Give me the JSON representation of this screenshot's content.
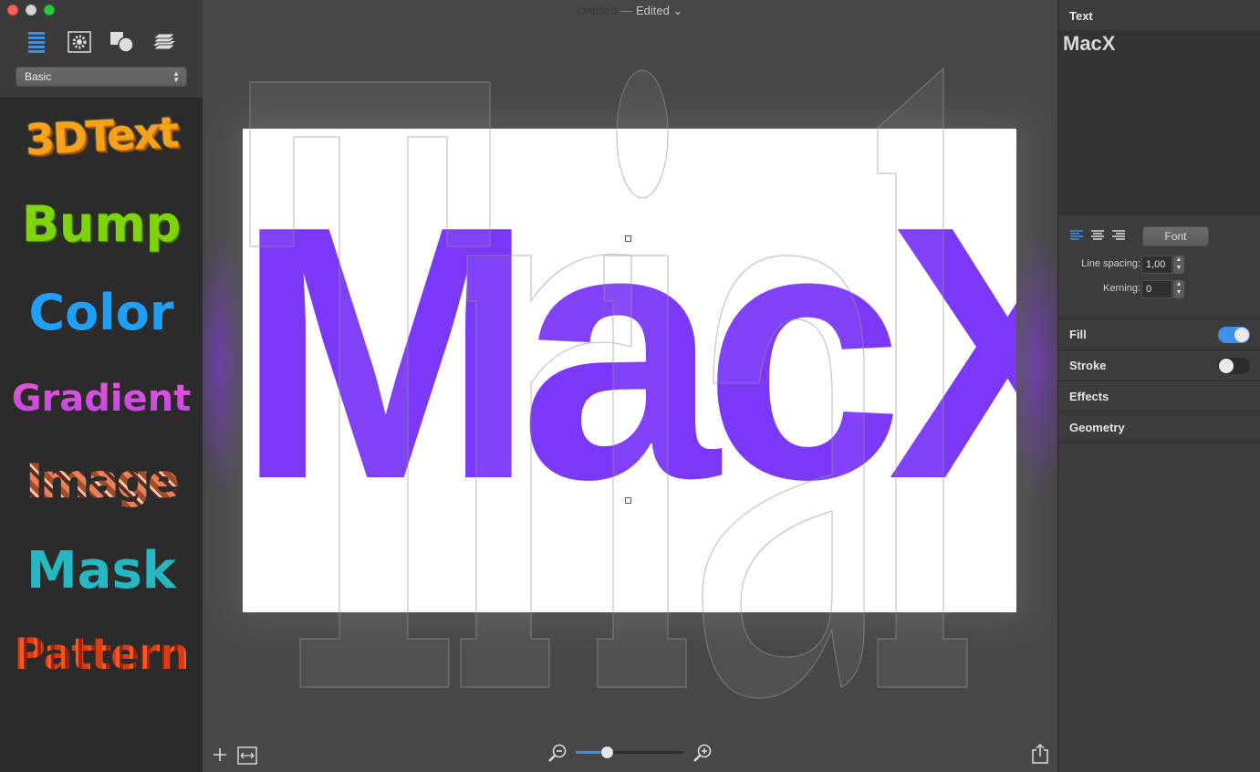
{
  "window": {
    "doc_name": "Untitled",
    "separator": "—",
    "status": "Edited",
    "status_chevron": "⌄"
  },
  "sidebar": {
    "toolbar_icons": [
      "list-icon",
      "gear-icon",
      "shapes-icon",
      "layers-icon"
    ],
    "preset_select": {
      "value": "Basic",
      "arrows": "▲\n▼"
    },
    "styles": [
      {
        "id": "3d",
        "label": "3DText"
      },
      {
        "id": "bump",
        "label": "Bump"
      },
      {
        "id": "color",
        "label": "Color"
      },
      {
        "id": "gradient",
        "label": "Gradient"
      },
      {
        "id": "image",
        "label": "Image"
      },
      {
        "id": "mask",
        "label": "Mask"
      },
      {
        "id": "pattern",
        "label": "Pattern"
      }
    ]
  },
  "canvas": {
    "text": "MacX",
    "text_color": "#7b38f7",
    "watermark_text": "Trial"
  },
  "bottom_bar": {
    "zoom_level": 0.29
  },
  "inspector": {
    "text_header": "Text",
    "text_value": "MacX",
    "font_button": "Font",
    "line_spacing": {
      "label": "Line spacing:",
      "value": "1,00"
    },
    "kerning": {
      "label": "Kerning:",
      "value": "0"
    },
    "stepper_glyph": "▲\n▼",
    "sections": {
      "fill": {
        "label": "Fill",
        "enabled": true
      },
      "stroke": {
        "label": "Stroke",
        "enabled": false
      },
      "effects": {
        "label": "Effects"
      },
      "geometry": {
        "label": "Geometry"
      }
    }
  },
  "colors": {
    "accent": "#3f8ee8",
    "purple": "#7b38f7"
  }
}
